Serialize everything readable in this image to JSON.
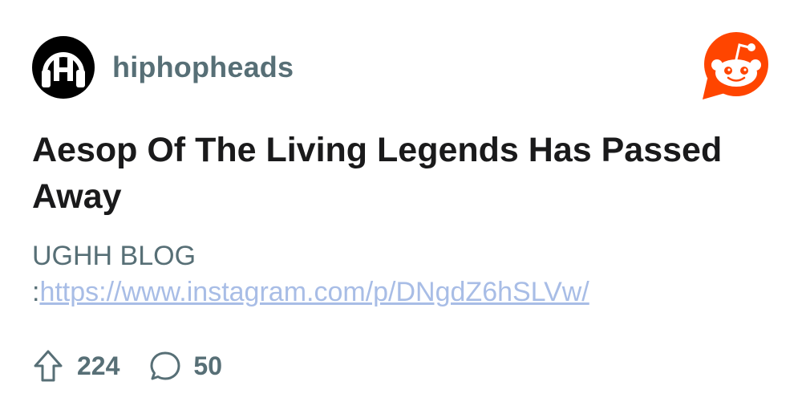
{
  "subreddit": {
    "name": "hiphopheads",
    "avatar_icon": "headphones-h-icon"
  },
  "brand": {
    "logo_icon": "reddit-snoo-icon",
    "accent_color": "#ff4500"
  },
  "post": {
    "title": "Aesop Of The Living Legends Has Passed Away",
    "body_prefix": "UGHH BLOG :",
    "body_link": "https://www.instagram.com/p/DNgdZ6hSLVw/",
    "upvotes": "224",
    "comments": "50"
  },
  "icons": {
    "upvote": "upvote-arrow-icon",
    "comment": "comment-bubble-icon"
  },
  "colors": {
    "text_muted": "#576f76",
    "title": "#1a1a1b",
    "link": "#a8bde6"
  }
}
